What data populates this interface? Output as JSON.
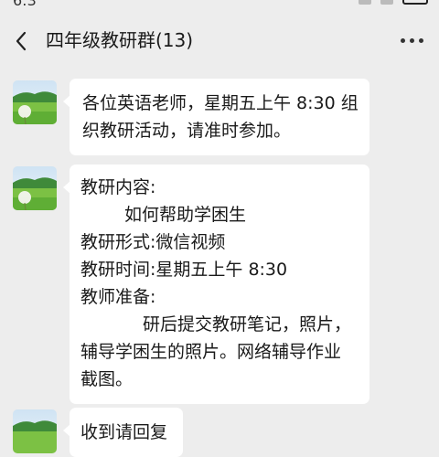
{
  "status_bar": {
    "time_fragment": "6:3"
  },
  "header": {
    "title": "四年级教研群(13)"
  },
  "messages": [
    {
      "lines": [
        "各位英语老师，星期五上午 8:30 组",
        "织教研活动，请准时参加。"
      ]
    },
    {
      "lines": [
        "教研内容:",
        "如何帮助学困生",
        "教研形式:微信视频",
        "教研时间:星期五上午 8:30",
        "教师准备:",
        "研后提交教研笔记，照片，",
        "辅导学困生的照片。网络辅导作业",
        "截图。"
      ]
    },
    {
      "lines": [
        "收到请回复"
      ]
    }
  ]
}
